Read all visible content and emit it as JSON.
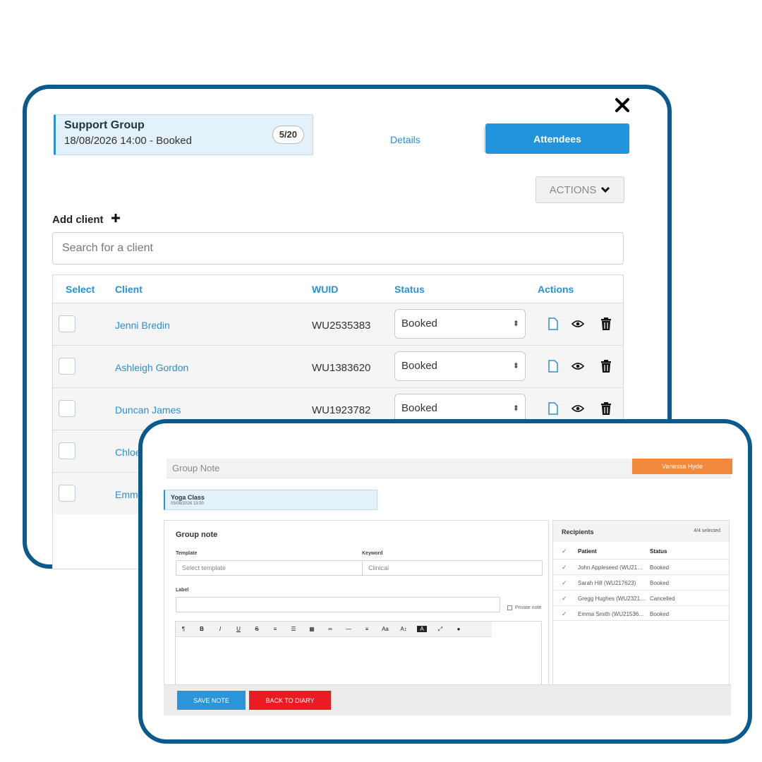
{
  "attendees_window": {
    "close_label": "×",
    "group": {
      "title": "Support Group",
      "subtitle": "18/08/2026 14:00 - Booked",
      "count": "5/20"
    },
    "tabs": [
      {
        "label": "Details",
        "active": false
      },
      {
        "label": "Attendees",
        "active": true
      }
    ],
    "actions_label": "ACTIONS",
    "add_client_label": "Add client",
    "search_placeholder": "Search for a client",
    "table": {
      "headers": {
        "select": "Select",
        "client": "Client",
        "wuid": "WUID",
        "status": "Status",
        "actions": "Actions"
      },
      "rows": [
        {
          "client": "Jenni Bredin",
          "wuid": "WU2535383",
          "status": "Booked"
        },
        {
          "client": "Ashleigh Gordon",
          "wuid": "WU1383620",
          "status": "Booked"
        },
        {
          "client": "Duncan James",
          "wuid": "WU1923782",
          "status": "Booked"
        },
        {
          "client": "Chloe",
          "wuid": "",
          "status": ""
        },
        {
          "client": "Emm",
          "wuid": "",
          "status": ""
        }
      ]
    }
  },
  "note_window": {
    "title": "Group Note",
    "user": "Vanessa Hyde",
    "event": {
      "title": "Yoga Class",
      "datetime": "05/08/2026 13:00"
    },
    "form": {
      "heading": "Group note",
      "template_label": "Template",
      "template_placeholder": "Select template",
      "keyword_label": "Keyword",
      "keyword_value": "Clinical",
      "label_label": "Label",
      "label_value": "",
      "private_label": "Private note",
      "toolbar": [
        "¶",
        "B",
        "I",
        "U",
        "S",
        "≡",
        "☰",
        "▦",
        "∞",
        "—",
        "≡",
        "Aa",
        "A↕",
        "A",
        "⤢",
        "●"
      ]
    },
    "recipients": {
      "title": "Recipients",
      "count": "4/4 selected",
      "headers": {
        "patient": "Patient",
        "status": "Status"
      },
      "rows": [
        {
          "patient": "John Appleseed (WU21…",
          "status": "Booked"
        },
        {
          "patient": "Sarah Hill (WU217623)",
          "status": "Booked"
        },
        {
          "patient": "Gregg Hughes (WU2321…",
          "status": "Cancelled"
        },
        {
          "patient": "Emma Smith (WU21536…",
          "status": "Booked"
        }
      ]
    },
    "save_label": "SAVE NOTE",
    "back_label": "BACK TO DIARY"
  },
  "colors": {
    "frame": "#0b5a8e",
    "accent": "#2293dd",
    "user_badge": "#f08a3a",
    "danger": "#ea1c22"
  }
}
